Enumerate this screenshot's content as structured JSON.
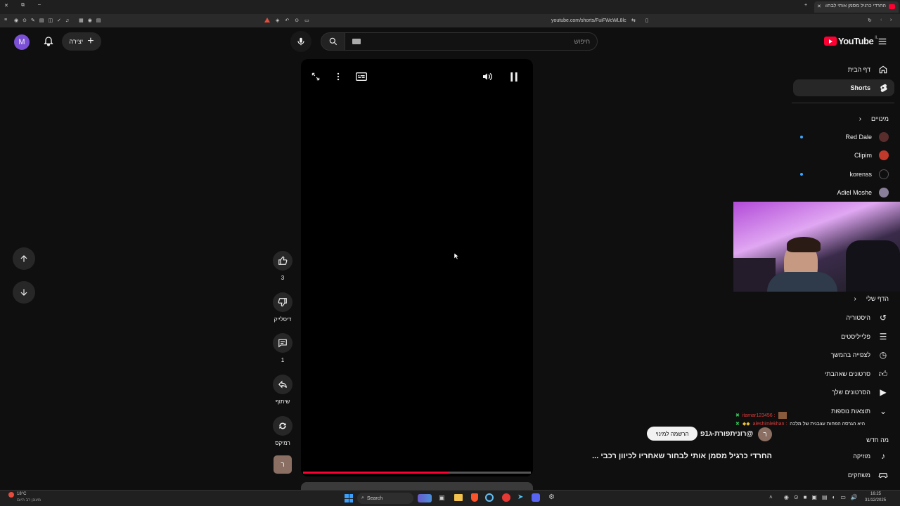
{
  "browser": {
    "tab_title": "החרדי כרגיל מסמן אותי לבחור...",
    "url": "youtube.com/shorts/FuiFWcWL8lc"
  },
  "header": {
    "logo_text": "YouTube",
    "logo_region": "IL",
    "search_placeholder": "חיפוש",
    "create_label": "יצירה",
    "avatar_letter": "M"
  },
  "sidebar": {
    "home": "דף הבית",
    "shorts": "Shorts",
    "subscriptions_header": "מינויים",
    "subscriptions": [
      {
        "name": "Red Dale",
        "color": "#5a2d2d",
        "new": true
      },
      {
        "name": "Clipim",
        "color": "#c0392b",
        "new": false
      },
      {
        "name": "korenss",
        "color": "#0f0f0f",
        "new": true
      },
      {
        "name": "Adiel Moshe",
        "color": "#8a7f9b",
        "new": false
      }
    ],
    "you_header": "הדף שלי",
    "you_items": [
      {
        "label": "היסטוריה",
        "icon": "history-icon"
      },
      {
        "label": "פלייליסטים",
        "icon": "playlists-icon"
      },
      {
        "label": "לצפייה בהמשך",
        "icon": "watch-later-icon"
      },
      {
        "label": "סרטונים שאהבתי",
        "icon": "liked-icon"
      },
      {
        "label": "הסרטונים שלך",
        "icon": "your-videos-icon"
      },
      {
        "label": "תוצאות נוספות",
        "icon": "chevron-down-icon"
      }
    ],
    "whats_new": "מה חדש",
    "music": "מוזיקה",
    "gaming": "משחקים"
  },
  "shorts": {
    "likes": "3",
    "dislike_label": "דיסלייק",
    "comments": "1",
    "share_label": "שיתוף",
    "remix_label": "רמיקס",
    "channel_avatar_letter": "ר",
    "channel_handle": "@רוניתפורת-ג1פ",
    "subscribe_label": "הרשמה למינוי",
    "title": "החרדי כרגיל מסמן אותי לבחור שאחריו לכיוון רכבי ...",
    "progress": 0.64,
    "progress_color": "#ff0033"
  },
  "chat": {
    "line1_user": "itamar123456 :",
    "line2_user": "aleshimlekhan :",
    "line2_text": "היא הגרסה הפחות עצבנית של מלכה"
  },
  "taskbar": {
    "weather_temp": "18°C",
    "weather_text": "מעונן רב היום",
    "search_label": "Search",
    "time": "16:25",
    "date": "31/12/2025"
  }
}
